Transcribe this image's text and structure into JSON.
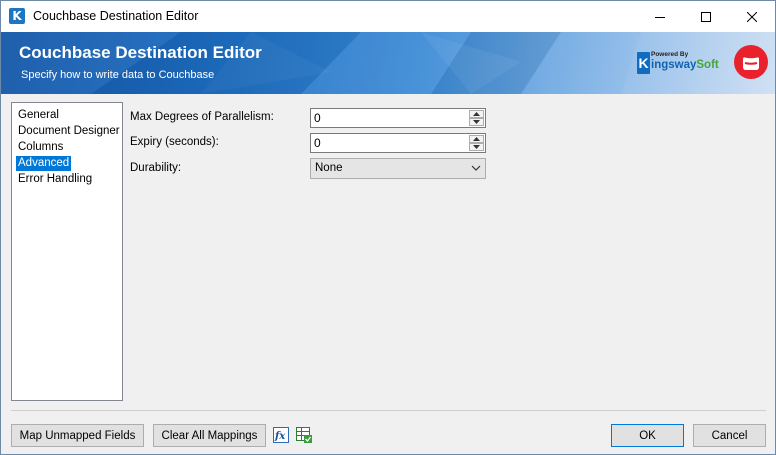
{
  "window": {
    "title": "Couchbase Destination Editor",
    "app_icon_letter": "K"
  },
  "banner": {
    "title": "Couchbase Destination Editor",
    "subtitle": "Specify how to write data to Couchbase",
    "brand_powered": "Powered By",
    "brand_k": "K",
    "brand_name_main": "ingsway",
    "brand_name_soft": "Soft"
  },
  "nav": {
    "items": [
      {
        "label": "General",
        "selected": false
      },
      {
        "label": "Document Designer",
        "selected": false
      },
      {
        "label": "Columns",
        "selected": false
      },
      {
        "label": "Advanced",
        "selected": true
      },
      {
        "label": "Error Handling",
        "selected": false
      }
    ]
  },
  "form": {
    "parallelism": {
      "label": "Max Degrees of Parallelism:",
      "value": "0"
    },
    "expiry": {
      "label": "Expiry (seconds):",
      "value": "0"
    },
    "durability": {
      "label": "Durability:",
      "value": "None"
    }
  },
  "footer": {
    "map_unmapped": "Map Unmapped Fields",
    "clear_mappings": "Clear All Mappings",
    "ok": "OK",
    "cancel": "Cancel"
  },
  "colors": {
    "accent": "#0078d7",
    "banner_blue": "#1e6fc4",
    "couchbase_red": "#e8212d",
    "brand_green": "#44a63a"
  }
}
